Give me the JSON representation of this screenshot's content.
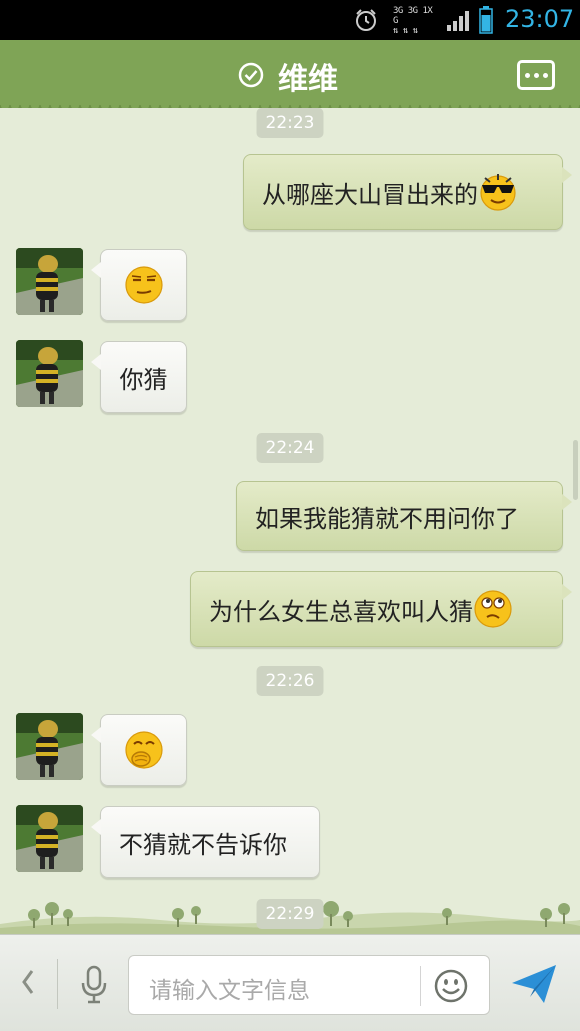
{
  "status_bar": {
    "time": "23:07",
    "network_top": "3G 3G 1X G",
    "network_bottom": "⇅ ⇅ ⇅",
    "alarm_icon": "alarm-clock-icon",
    "signal_icon": "signal-bars-icon",
    "battery_icon": "battery-icon"
  },
  "header": {
    "title": "维维",
    "status_icon": "check-circle-icon",
    "menu_icon": "more-menu-icon"
  },
  "messages": [
    {
      "type": "timestamp",
      "text": "22:23"
    },
    {
      "type": "sent",
      "text": "从哪座大山冒出来的",
      "emoji": "cool-sunglasses-emoji"
    },
    {
      "type": "received",
      "text": "",
      "emoji": "smug-face-emoji"
    },
    {
      "type": "received",
      "text": "你猜"
    },
    {
      "type": "timestamp",
      "text": "22:24"
    },
    {
      "type": "sent",
      "text": "如果我能猜就不用问你了"
    },
    {
      "type": "sent",
      "text": "为什么女生总喜欢叫人猜",
      "emoji": "puzzled-face-emoji"
    },
    {
      "type": "timestamp",
      "text": "22:26"
    },
    {
      "type": "received",
      "text": "",
      "emoji": "giggle-face-emoji"
    },
    {
      "type": "received",
      "text": "不猜就不告诉你"
    },
    {
      "type": "timestamp",
      "text": "22:29"
    }
  ],
  "input_bar": {
    "placeholder": "请输入文字信息",
    "back_icon": "chevron-left-icon",
    "mic_icon": "microphone-icon",
    "emoji_icon": "smiley-icon",
    "send_icon": "send-paper-plane-icon"
  },
  "colors": {
    "header": "#7fa456",
    "chat_background": "#e5ecd8",
    "sent_bubble": "#d6e0b5",
    "received_bubble": "#f4f5f1",
    "timestamp_badge": "#cdd3c2",
    "clock_text": "#33b5e5"
  }
}
